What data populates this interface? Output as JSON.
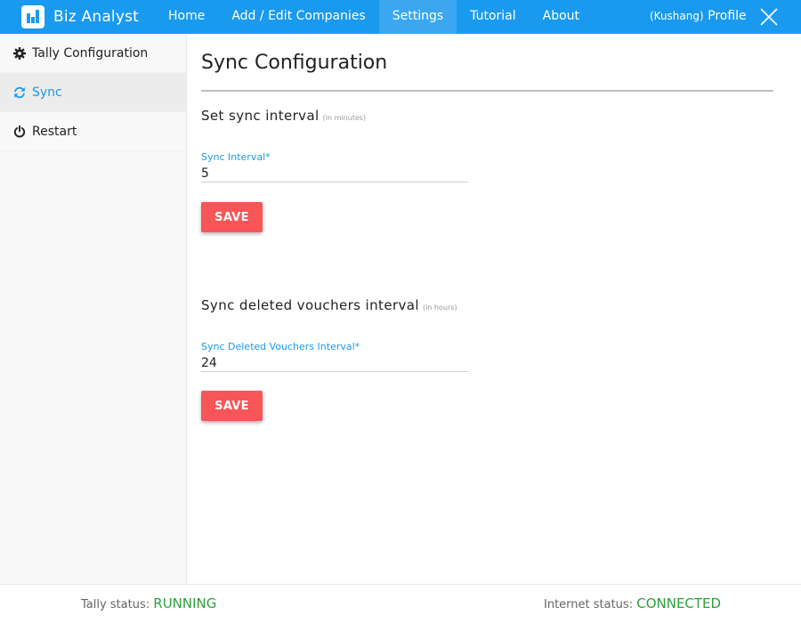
{
  "app": {
    "brand": "Biz Analyst",
    "brand_icon": "bar-chart-icon"
  },
  "nav": {
    "items": [
      {
        "label": "Home"
      },
      {
        "label": "Add / Edit Companies"
      },
      {
        "label": "Settings"
      },
      {
        "label": "Tutorial"
      },
      {
        "label": "About"
      }
    ],
    "active": "Settings",
    "profile_user": "(Kushang)",
    "profile_label": "Profile",
    "close_icon": "close-icon"
  },
  "sidebar": {
    "items": [
      {
        "label": "Tally Configuration",
        "icon": "gear-icon"
      },
      {
        "label": "Sync",
        "icon": "refresh-icon"
      },
      {
        "label": "Restart",
        "icon": "power-icon"
      }
    ],
    "active": "Sync"
  },
  "main": {
    "title": "Sync Configuration",
    "sections": [
      {
        "title": "Set sync interval",
        "unit": "(in minutes)",
        "field_label": "Sync Interval*",
        "field_value": "5",
        "save_label": "SAVE"
      },
      {
        "title": "Sync deleted vouchers interval",
        "unit": "(in hours)",
        "field_label": "Sync Deleted Vouchers Interval*",
        "field_value": "24",
        "save_label": "SAVE"
      }
    ]
  },
  "footer": {
    "tally_label": "Tally status:",
    "tally_value": "RUNNING",
    "internet_label": "Internet status:",
    "internet_value": "CONNECTED"
  },
  "colors": {
    "header": "#1a9aee",
    "header_active": "#3aa7f0",
    "accent": "#1a9aee",
    "save_button": "#f75557",
    "status_ok": "#2e9e3c"
  }
}
